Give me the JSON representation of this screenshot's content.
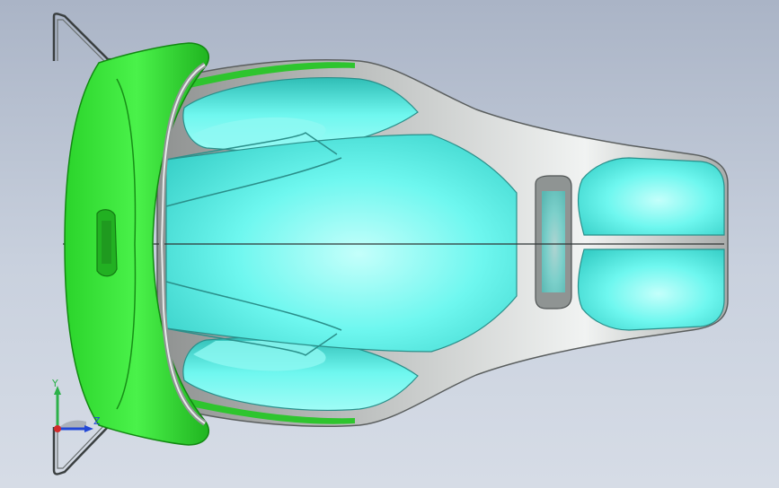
{
  "viewport": {
    "background_top": "#aab4c6",
    "background_bottom": "#d6dce6"
  },
  "model": {
    "parts": [
      "seat-shell",
      "headrest-frame",
      "seat-cushion",
      "wire-bracket"
    ],
    "colors": {
      "headrest": "#33e833",
      "headrest_dark": "#22b922",
      "cushion": "#5ff6ee",
      "cushion_light": "#b8fffb",
      "cushion_dark": "#2fc5bd",
      "shell": "#b9bcbb",
      "shell_light": "#eceeed",
      "tube": "#8f9493",
      "wire": "#3a3f40"
    }
  },
  "triad": {
    "y_label": "Y",
    "z_label": "Z",
    "x_label": "",
    "y_color": "#2db14a",
    "z_color": "#2248d6",
    "x_color": "#d22b2b",
    "icons": [
      "triad-y-axis-icon",
      "triad-z-axis-icon",
      "triad-origin-icon"
    ]
  }
}
